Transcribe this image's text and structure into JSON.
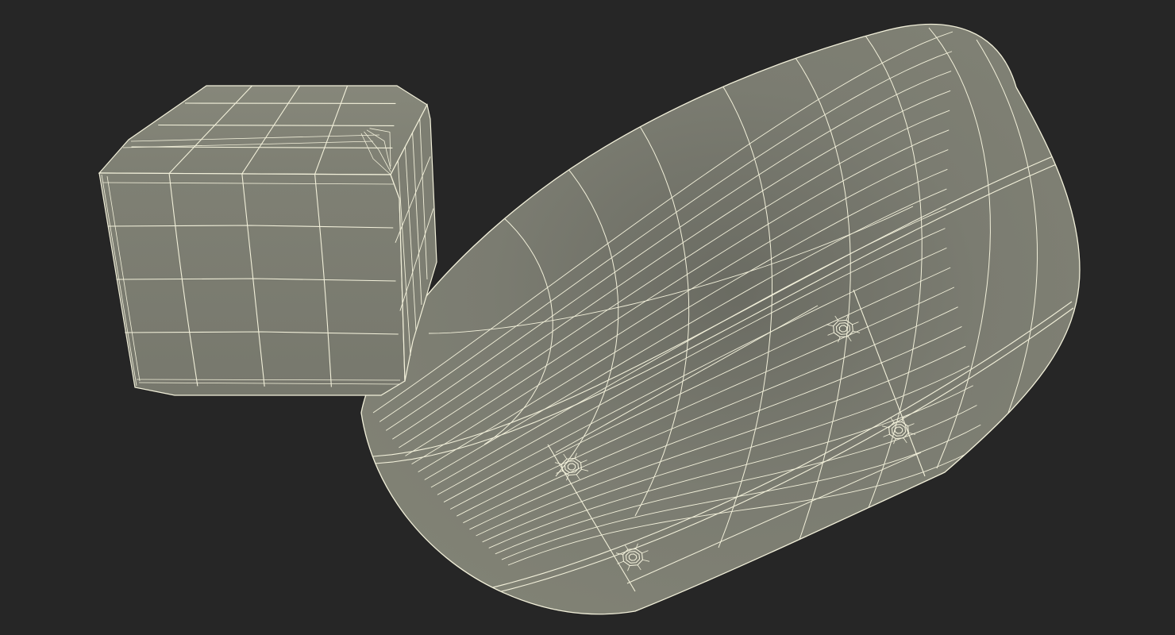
{
  "scene": {
    "background_color": "#262626",
    "surface_color": "#7d7e72",
    "surface_shadow_color": "#5f6058",
    "wire_color": "#f2f0da",
    "objects": [
      {
        "name": "rounded-cube-mesh",
        "kind": "cube",
        "grid_divisions": 5
      },
      {
        "name": "rounded-oval-mesh",
        "kind": "oval-capsule",
        "screw_holes": 4
      }
    ]
  }
}
